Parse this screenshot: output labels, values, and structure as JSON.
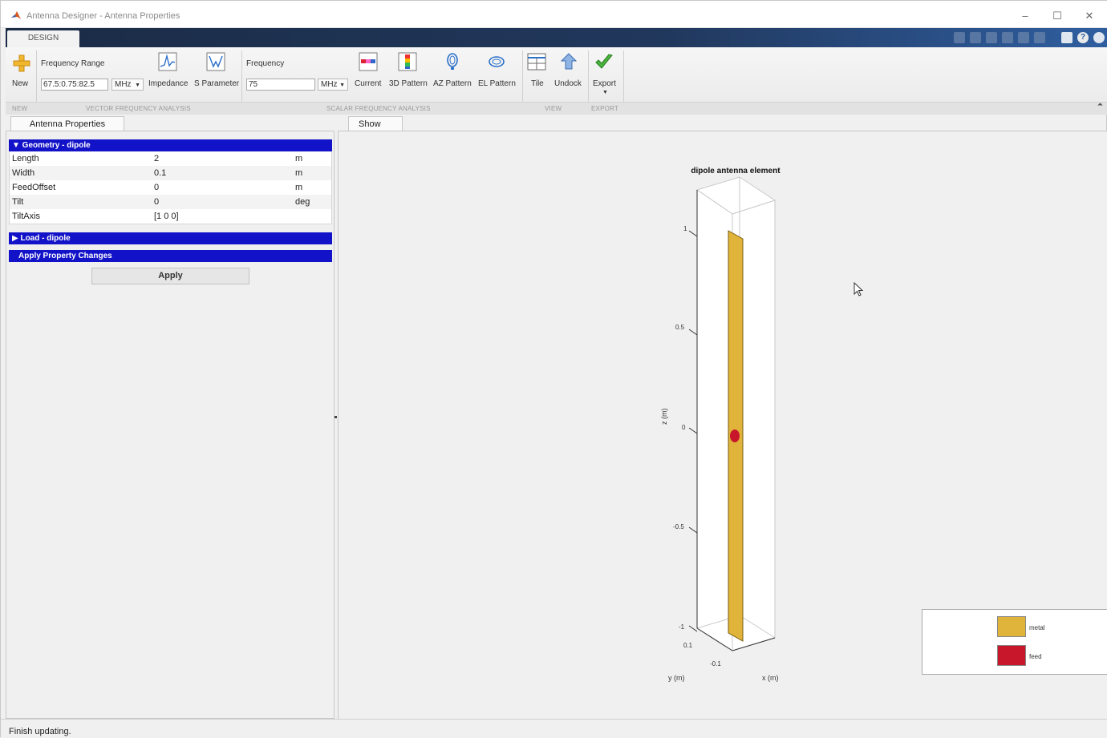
{
  "window": {
    "title": "Antenna Designer - Antenna Properties",
    "minimize": "–",
    "maximize": "☐",
    "close": "✕"
  },
  "ribbon": {
    "tab": "DESIGN",
    "new_label": "New",
    "frequency_range_label": "Frequency Range",
    "frequency_range_value": "67.5:0.75:82.5",
    "frequency_range_unit": "MHz",
    "impedance_label": "Impedance",
    "sparameter_label": "S Parameter",
    "frequency_label": "Frequency",
    "frequency_value": "75",
    "frequency_unit": "MHz",
    "current_label": "Current",
    "pattern3d_label": "3D Pattern",
    "azpattern_label": "AZ Pattern",
    "elpattern_label": "EL Pattern",
    "tile_label": "Tile",
    "undock_label": "Undock",
    "export_label": "Export",
    "sections": {
      "new": "NEW",
      "vector": "VECTOR FREQUENCY ANALYSIS",
      "scalar": "SCALAR FREQUENCY ANALYSIS",
      "view": "VIEW",
      "export": "EXPORT"
    }
  },
  "left_panel": {
    "tab": "Antenna Properties",
    "geometry_header": "▼ Geometry - dipole",
    "properties": [
      {
        "name": "Length",
        "value": "2",
        "unit": "m"
      },
      {
        "name": "Width",
        "value": "0.1",
        "unit": "m"
      },
      {
        "name": "FeedOffset",
        "value": "0",
        "unit": "m"
      },
      {
        "name": "Tilt",
        "value": "0",
        "unit": "deg"
      },
      {
        "name": "TiltAxis",
        "value": "[1 0 0]",
        "unit": ""
      }
    ],
    "load_header": "▶ Load - dipole",
    "apply_header": "Apply Property Changes",
    "apply_button": "Apply"
  },
  "right_panel": {
    "tab": "Show"
  },
  "chart_data": {
    "type": "3d-geometry",
    "title": "dipole antenna element",
    "zlabel": "z (m)",
    "ylabel": "y (m)",
    "xlabel": "x (m)",
    "z_ticks": [
      "1",
      "0.5",
      "0",
      "-0.5",
      "-1"
    ],
    "y_ticks": [
      "0.1"
    ],
    "x_ticks": [
      "-0.1"
    ],
    "legend": [
      {
        "name": "metal",
        "color": "#e0b43a"
      },
      {
        "name": "feed",
        "color": "#c8172b"
      }
    ]
  },
  "status": {
    "text": "Finish updating."
  },
  "colors": {
    "ribbon_dark": "#1a2b45",
    "section_header": "#1212c8",
    "metal": "#e0b43a",
    "feed": "#c8172b"
  }
}
